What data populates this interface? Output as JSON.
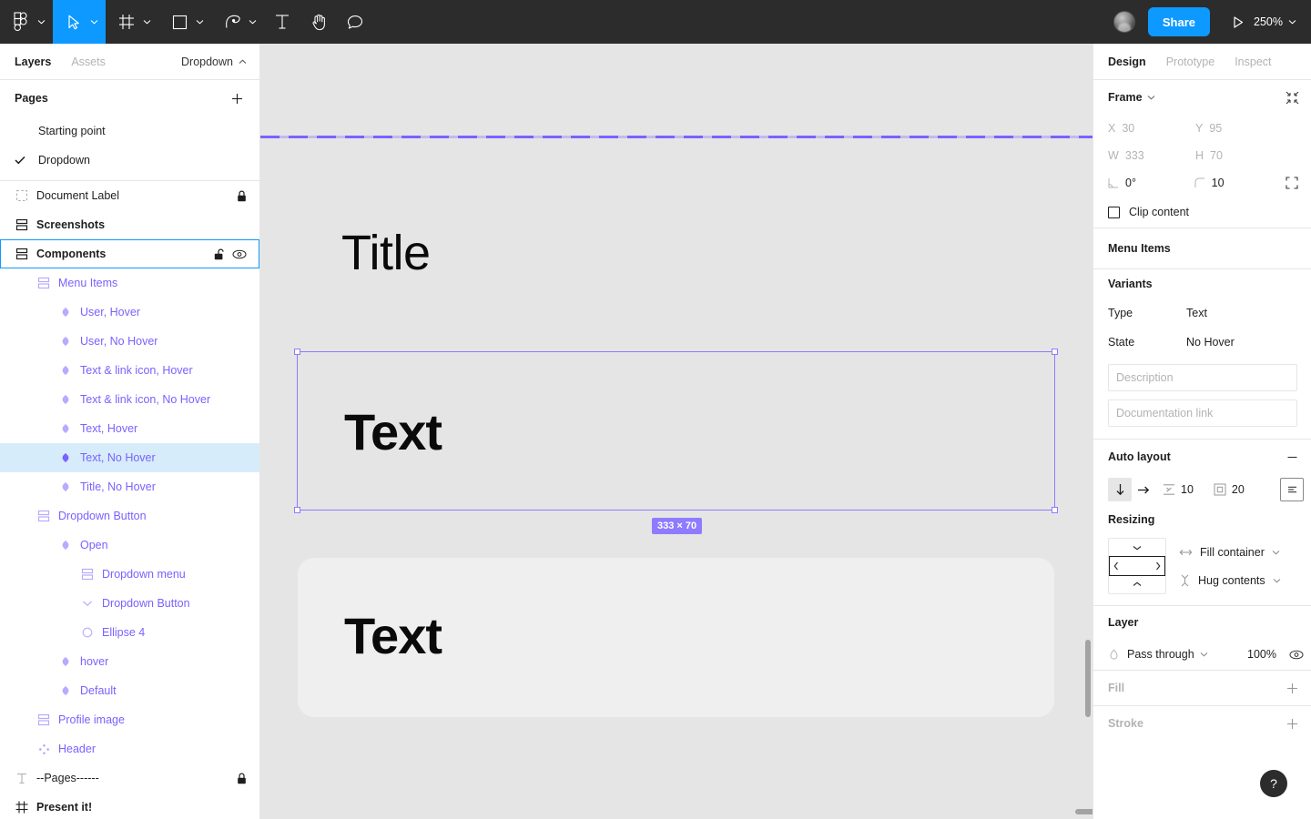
{
  "toolbar": {
    "menu_icon": "figma-logo-icon",
    "tools": [
      {
        "name": "main-menu",
        "icon": "figma-logo-icon",
        "caret": true,
        "active": false
      },
      {
        "name": "move-tool",
        "icon": "cursor-arrow-icon",
        "caret": true,
        "active": true
      },
      {
        "name": "frame-tool",
        "icon": "frame-icon",
        "caret": true,
        "active": false
      },
      {
        "name": "shape-tool",
        "icon": "square-icon",
        "caret": true,
        "active": false
      },
      {
        "name": "pen-tool",
        "icon": "pen-icon",
        "caret": true,
        "active": false
      },
      {
        "name": "text-tool",
        "icon": "text-t-icon",
        "caret": false,
        "active": false
      },
      {
        "name": "hand-tool",
        "icon": "hand-icon",
        "caret": false,
        "active": false
      },
      {
        "name": "comment-tool",
        "icon": "comment-bubble-icon",
        "caret": false,
        "active": false
      }
    ],
    "share_label": "Share",
    "present_icon": "play-triangle-icon",
    "zoom_level": "250%",
    "avatar_name": "user-avatar"
  },
  "left_panel": {
    "tabs": [
      {
        "label": "Layers",
        "active": true
      },
      {
        "label": "Assets",
        "active": false
      }
    ],
    "file_name": "Dropdown",
    "pages_label": "Pages",
    "add_page_icon": "plus-icon",
    "pages": [
      {
        "label": "Starting point",
        "current": false
      },
      {
        "label": "Dropdown",
        "current": true
      }
    ],
    "layers": [
      {
        "label": "Document Label",
        "icon": "component-set-dashed-icon",
        "indent": 0,
        "bold": false,
        "component": false,
        "lock": true,
        "eye": false,
        "selected": false,
        "highlight": false
      },
      {
        "label": "Screenshots",
        "icon": "section-icon",
        "indent": 0,
        "bold": true,
        "component": false,
        "lock": false,
        "eye": false,
        "selected": false,
        "highlight": false
      },
      {
        "label": "Components",
        "icon": "section-icon",
        "indent": 0,
        "bold": true,
        "component": false,
        "lock": false,
        "eye": true,
        "unlock": true,
        "selected": true,
        "highlight": false
      },
      {
        "label": "Menu Items",
        "icon": "section-icon",
        "indent": 1,
        "bold": false,
        "component": true,
        "lock": false,
        "eye": false,
        "selected": false,
        "highlight": false
      },
      {
        "label": "User, Hover",
        "icon": "variant-diamond-icon",
        "indent": 2,
        "bold": false,
        "component": true,
        "lock": false,
        "eye": false,
        "selected": false,
        "highlight": false
      },
      {
        "label": "User, No Hover",
        "icon": "variant-diamond-icon",
        "indent": 2,
        "bold": false,
        "component": true,
        "lock": false,
        "eye": false,
        "selected": false,
        "highlight": false
      },
      {
        "label": "Text & link icon, Hover",
        "icon": "variant-diamond-icon",
        "indent": 2,
        "bold": false,
        "component": true,
        "lock": false,
        "eye": false,
        "selected": false,
        "highlight": false
      },
      {
        "label": "Text & link icon, No Hover",
        "icon": "variant-diamond-icon",
        "indent": 2,
        "bold": false,
        "component": true,
        "lock": false,
        "eye": false,
        "selected": false,
        "highlight": false
      },
      {
        "label": "Text, Hover",
        "icon": "variant-diamond-icon",
        "indent": 2,
        "bold": false,
        "component": true,
        "lock": false,
        "eye": false,
        "selected": false,
        "highlight": false
      },
      {
        "label": "Text, No Hover",
        "icon": "variant-diamond-solid-icon",
        "indent": 2,
        "bold": false,
        "component": true,
        "lock": false,
        "eye": false,
        "selected": false,
        "highlight": true
      },
      {
        "label": "Title, No Hover",
        "icon": "variant-diamond-icon",
        "indent": 2,
        "bold": false,
        "component": true,
        "lock": false,
        "eye": false,
        "selected": false,
        "highlight": false
      },
      {
        "label": "Dropdown Button",
        "icon": "section-icon",
        "indent": 1,
        "bold": false,
        "component": true,
        "lock": false,
        "eye": false,
        "selected": false,
        "highlight": false
      },
      {
        "label": "Open",
        "icon": "variant-diamond-icon",
        "indent": 2,
        "bold": false,
        "component": true,
        "lock": false,
        "eye": false,
        "selected": false,
        "highlight": false
      },
      {
        "label": "Dropdown menu",
        "icon": "section-icon",
        "indent": 3,
        "bold": false,
        "component": true,
        "lock": false,
        "eye": false,
        "selected": false,
        "highlight": false
      },
      {
        "label": "Dropdown Button",
        "icon": "chevron-down-icon",
        "indent": 3,
        "bold": false,
        "component": true,
        "lock": false,
        "eye": false,
        "selected": false,
        "highlight": false
      },
      {
        "label": "Ellipse 4",
        "icon": "ellipse-icon",
        "indent": 3,
        "bold": false,
        "component": true,
        "lock": false,
        "eye": false,
        "selected": false,
        "highlight": false
      },
      {
        "label": "hover",
        "icon": "variant-diamond-icon",
        "indent": 2,
        "bold": false,
        "component": true,
        "lock": false,
        "eye": false,
        "selected": false,
        "highlight": false
      },
      {
        "label": "Default",
        "icon": "variant-diamond-icon",
        "indent": 2,
        "bold": false,
        "component": true,
        "lock": false,
        "eye": false,
        "selected": false,
        "highlight": false
      },
      {
        "label": "Profile image",
        "icon": "section-icon",
        "indent": 1,
        "bold": false,
        "component": true,
        "lock": false,
        "eye": false,
        "selected": false,
        "highlight": false
      },
      {
        "label": "Header",
        "icon": "component-instance-icon",
        "indent": 1,
        "bold": false,
        "component": true,
        "lock": false,
        "eye": false,
        "selected": false,
        "highlight": false
      },
      {
        "label": "--Pages------",
        "icon": "text-t-icon",
        "indent": 0,
        "bold": false,
        "component": false,
        "lock": true,
        "eye": false,
        "selected": false,
        "highlight": false
      },
      {
        "label": "Present it!",
        "icon": "frame-icon",
        "indent": 0,
        "bold": true,
        "component": false,
        "lock": false,
        "eye": false,
        "selected": false,
        "highlight": false
      }
    ]
  },
  "canvas": {
    "title_text": "Title",
    "selected_text": "Text",
    "card_text": "Text",
    "size_badge": "333 × 70",
    "selection_color": "#8f7bff",
    "cursor_icon": "mouse-pointer-icon"
  },
  "right_panel": {
    "tabs": [
      {
        "label": "Design",
        "active": true
      },
      {
        "label": "Prototype",
        "active": false
      },
      {
        "label": "Inspect",
        "active": false
      }
    ],
    "frame": {
      "title": "Frame",
      "collapse_icon": "collapse-arrows-icon",
      "x_label": "X",
      "x_value": "30",
      "y_label": "Y",
      "y_value": "95",
      "w_label": "W",
      "w_value": "333",
      "h_label": "H",
      "h_value": "70",
      "rotation_label": "rotation-icon",
      "rotation_value": "0°",
      "corner_label": "corner-radius-icon",
      "corner_value": "10",
      "independent_corners_icon": "independent-corners-icon",
      "clip_content_label": "Clip content",
      "clip_content_checked": false
    },
    "component": {
      "name": "Menu Items",
      "variants_label": "Variants",
      "properties": [
        {
          "key": "Type",
          "value": "Text"
        },
        {
          "key": "State",
          "value": "No Hover"
        }
      ],
      "description_placeholder": "Description",
      "documentation_placeholder": "Documentation link"
    },
    "auto_layout": {
      "title": "Auto layout",
      "remove_icon": "minus-icon",
      "direction_vertical_icon": "arrow-down-icon",
      "direction_horizontal_icon": "arrow-right-icon",
      "direction_vertical_active": true,
      "spacing_icon": "spacing-between-icon",
      "spacing_value": "10",
      "padding_icon": "padding-icon",
      "padding_value": "20",
      "align_icon": "text-align-icon"
    },
    "resizing": {
      "title": "Resizing",
      "horizontal_icon": "resize-horizontal-icon",
      "horizontal_value": "Fill container",
      "vertical_icon": "resize-vertical-icon",
      "vertical_value": "Hug contents"
    },
    "layer": {
      "title": "Layer",
      "blend_icon": "blend-mode-icon",
      "blend_mode": "Pass through",
      "opacity": "100%",
      "visibility_icon": "eye-icon"
    },
    "fill": {
      "title": "Fill",
      "add_icon": "plus-icon"
    },
    "stroke": {
      "title": "Stroke",
      "add_icon": "plus-icon"
    },
    "help_label": "?"
  }
}
